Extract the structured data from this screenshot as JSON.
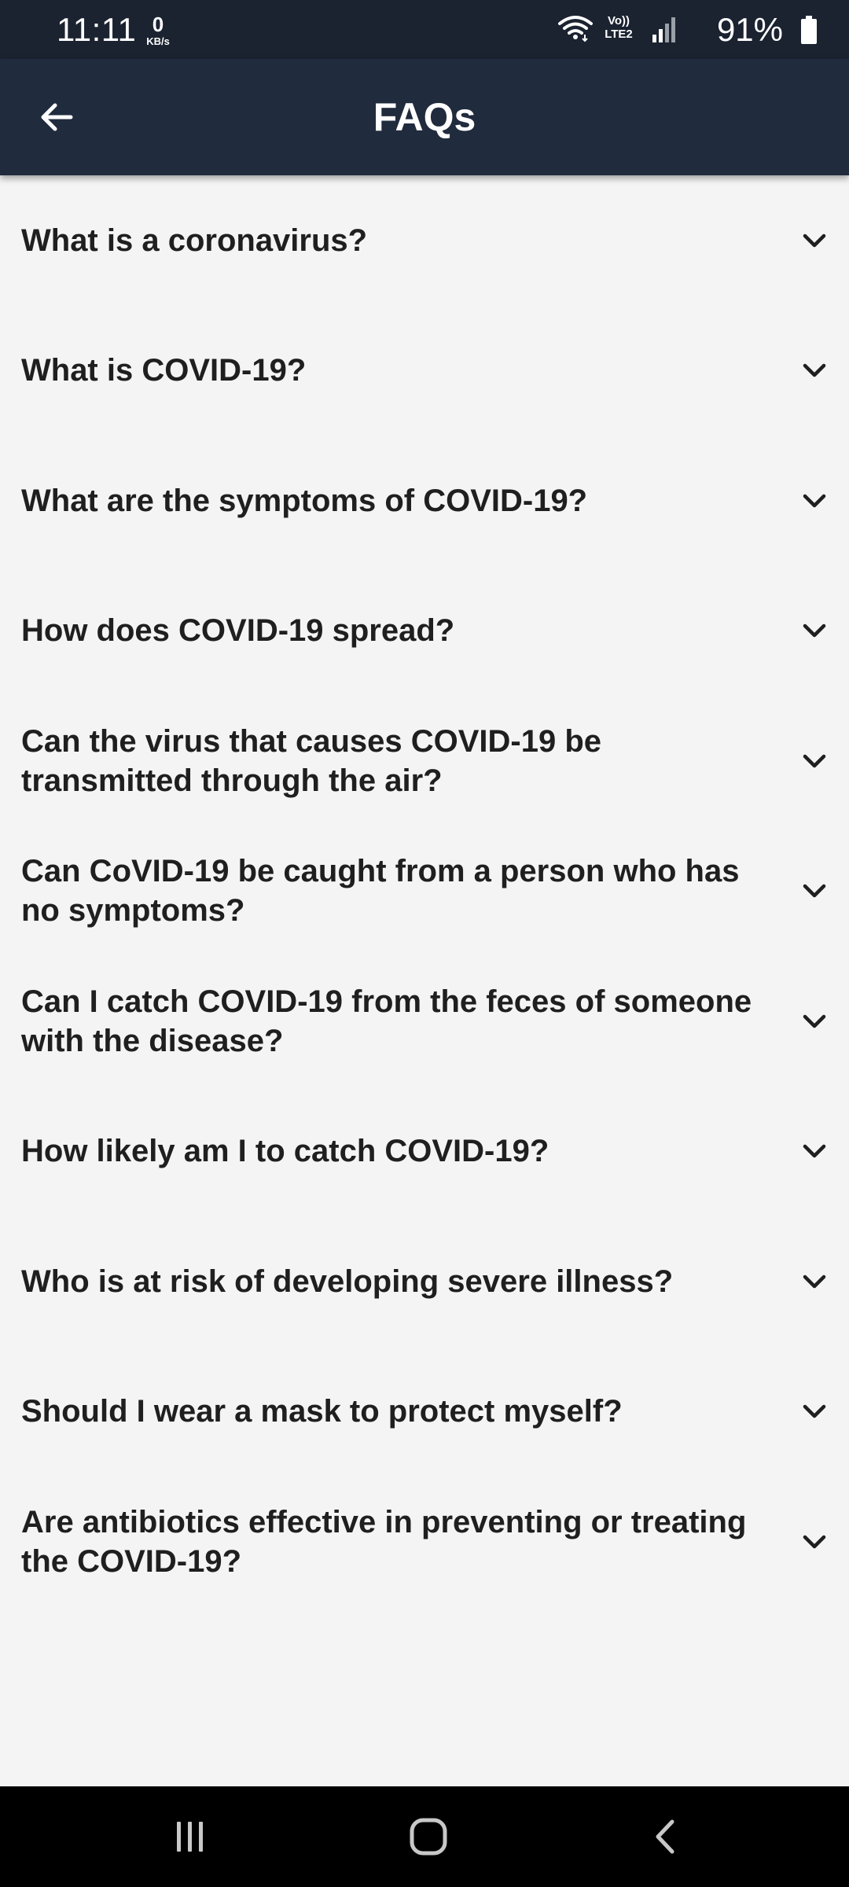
{
  "status_bar": {
    "time": "11:11",
    "net_speed_value": "0",
    "net_speed_unit": "KB/s",
    "volte_top": "Vo))",
    "volte_bottom": "LTE2",
    "battery_percent": "91%",
    "icons": [
      "wifi-icon",
      "volte-icon",
      "signal-icon",
      "battery-icon"
    ]
  },
  "app_bar": {
    "title": "FAQs",
    "back_icon": "arrow-left-icon"
  },
  "faq": {
    "items": [
      {
        "question": "What is a coronavirus?"
      },
      {
        "question": "What is COVID-19?"
      },
      {
        "question": "What are the symptoms of COVID-19?"
      },
      {
        "question": "How does COVID-19 spread?"
      },
      {
        "question": "Can the virus that causes COVID-19 be transmitted through the air?"
      },
      {
        "question": "Can CoVID-19 be caught from a person who has no symptoms?"
      },
      {
        "question": "Can I catch COVID-19 from the feces of someone with the disease?"
      },
      {
        "question": "How likely am I to catch COVID-19?"
      },
      {
        "question": "Who is at risk of developing severe illness?"
      },
      {
        "question": "Should I wear a mask to protect myself?"
      },
      {
        "question": "Are antibiotics effective in preventing or treating the COVID-19?"
      }
    ],
    "expand_icon": "chevron-down-icon"
  },
  "nav_bar": {
    "icons": [
      "recents-icon",
      "home-icon",
      "back-icon"
    ]
  },
  "colors": {
    "status_bar_bg": "#1b2230",
    "app_bar_bg": "#202b3d",
    "page_bg": "#f4f4f4",
    "text": "#1f1f1f"
  }
}
